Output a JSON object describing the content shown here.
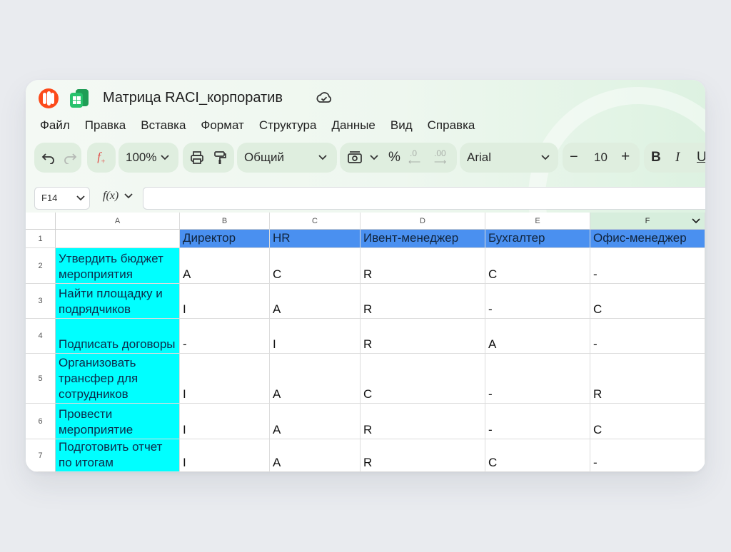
{
  "window": {
    "title": "Матрица RACI_корпоратив",
    "logo_icon": "yandex-360-logo",
    "app_icon": "tables-app-icon",
    "save_status_icon": "cloud-check-icon"
  },
  "menu": [
    "Файл",
    "Правка",
    "Вставка",
    "Формат",
    "Структура",
    "Данные",
    "Вид",
    "Справка"
  ],
  "toolbar": {
    "undo_icon": "undo-icon",
    "redo_icon": "redo-icon",
    "function_icon": "insert-function-icon",
    "zoom": "100%",
    "print_icon": "print-icon",
    "paint_format_icon": "paint-format-icon",
    "number_format": "Общий",
    "currency_icon": "currency-format-icon",
    "percent": "%",
    "decrease_decimals": ".0",
    "increase_decimals": ".00",
    "font": "Arial",
    "font_size": "10",
    "bold": "B",
    "italic": "I",
    "underline": "U"
  },
  "formula_bar": {
    "cell_ref": "F14",
    "fx_label": "f(x)",
    "value": ""
  },
  "columns": [
    "A",
    "B",
    "C",
    "D",
    "E",
    "F"
  ],
  "selected_column": "F",
  "rows": [
    "1",
    "2",
    "3",
    "4",
    "5",
    "6",
    "7"
  ],
  "table": {
    "header": [
      "",
      "Директор",
      "HR",
      "Ивент-менеджер",
      "Бухгалтер",
      "Офис-менеджер"
    ],
    "body": [
      [
        "Утвердить бюджет мероприятия",
        "A",
        "C",
        "R",
        "C",
        "-"
      ],
      [
        "Найти площадку и подрядчиков",
        "I",
        "A",
        "R",
        "-",
        "C"
      ],
      [
        "Подписать договоры",
        "-",
        "I",
        "R",
        "A",
        "-"
      ],
      [
        "Организовать трансфер для сотрудников",
        "I",
        "A",
        "C",
        "-",
        "R"
      ],
      [
        "Провести мероприятие",
        "I",
        "A",
        "R",
        "-",
        "C"
      ],
      [
        "Подготовить отчет по итогам",
        "I",
        "A",
        "R",
        "C",
        "-"
      ]
    ]
  },
  "colors": {
    "header_fill": "#4a90f0",
    "task_fill": "#00ffff",
    "accent_green": "#d7eedd"
  }
}
